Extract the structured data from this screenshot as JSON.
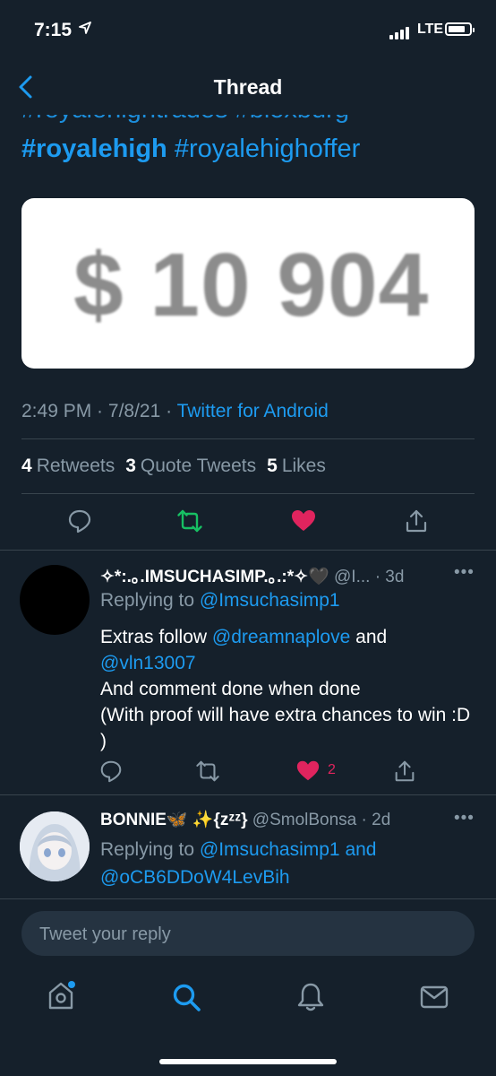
{
  "status_bar": {
    "time": "7:15",
    "network": "LTE"
  },
  "nav": {
    "title": "Thread"
  },
  "tweet": {
    "hashtags_partial": "#royalehightrades #bloxburg",
    "hashtags_bold": "#royalehigh",
    "hashtags_rest": " #royalehighoffer",
    "image_text": "$ 10 904",
    "time": "2:49 PM",
    "date": "7/8/21",
    "source": "Twitter for Android",
    "retweets_count": "4",
    "retweets_label": "Retweets",
    "quotes_count": "3",
    "quotes_label": "Quote Tweets",
    "likes_count": "5",
    "likes_label": "Likes",
    "accent_colors": {
      "link": "#1d9bf0",
      "retweet": "#17bf63",
      "like": "#e0245e"
    }
  },
  "replies": [
    {
      "name": "✧*:.｡.IMSUCHASIMP.｡.:*✧🖤",
      "handle": "@I...",
      "age": "· 3d",
      "replying_prefix": "Replying to",
      "replying_to": "@Imsuchasimp1",
      "text_1": "Extras follow",
      "mention_1": "@dreamnaplove",
      "text_2": "and",
      "mention_2": "@vln13007",
      "text_3": "And comment done when done",
      "text_4": "(With proof will have extra chances to win :D )",
      "like_count": "2"
    },
    {
      "name": "BONNIE🦋 ✨{zᶻᶻ}",
      "handle": "@SmolBonsa",
      "age": "· 2d",
      "replying_prefix": "Replying to",
      "replying_to": "@Imsuchasimp1 and",
      "replying_to_2": "@oCB6DDoW4LevBih"
    }
  ],
  "composer": {
    "placeholder": "Tweet your reply"
  },
  "tabbar": {
    "items": [
      "home-icon",
      "search-icon",
      "notifications-icon",
      "messages-icon"
    ]
  }
}
